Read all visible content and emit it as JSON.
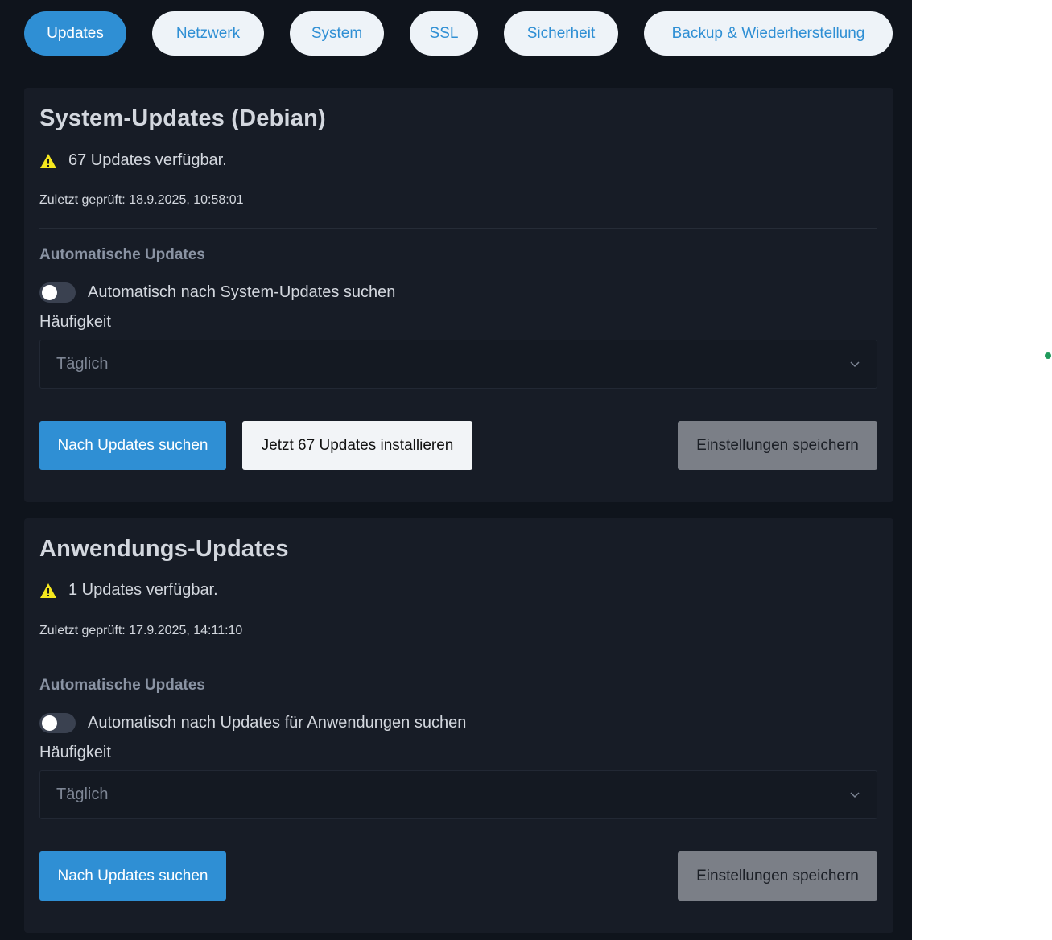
{
  "tabs": [
    {
      "label": "Updates",
      "active": true
    },
    {
      "label": "Netzwerk",
      "active": false
    },
    {
      "label": "System",
      "active": false
    },
    {
      "label": "SSL",
      "active": false
    },
    {
      "label": "Sicherheit",
      "active": false
    },
    {
      "label": "Backup & Wiederherstellung",
      "active": false
    }
  ],
  "system_updates": {
    "title": "System-Updates (Debian)",
    "status": "67 Updates verfügbar.",
    "last_checked": "Zuletzt geprüft: 18.9.2025, 10:58:01",
    "auto_label": "Automatische Updates",
    "toggle_label": "Automatisch nach System-Updates suchen",
    "toggle_on": false,
    "frequency_label": "Häufigkeit",
    "frequency_value": "Täglich",
    "check_button": "Nach Updates suchen",
    "install_button": "Jetzt 67 Updates installieren",
    "save_button": "Einstellungen speichern"
  },
  "app_updates": {
    "title": "Anwendungs-Updates",
    "status": "1 Updates verfügbar.",
    "last_checked": "Zuletzt geprüft: 17.9.2025, 14:11:10",
    "auto_label": "Automatische Updates",
    "toggle_label": "Automatisch nach Updates für Anwendungen suchen",
    "toggle_on": false,
    "frequency_label": "Häufigkeit",
    "frequency_value": "Täglich",
    "check_button": "Nach Updates suchen",
    "save_button": "Einstellungen speichern"
  },
  "colors": {
    "accent": "#2f8fd4",
    "background": "#0f141c",
    "card": "#171c26",
    "warning": "#f5e71e",
    "status_dot": "#1f9a5b"
  },
  "icons": {
    "warning": "warning-icon",
    "select_arrow": "chevron-down-icon"
  }
}
